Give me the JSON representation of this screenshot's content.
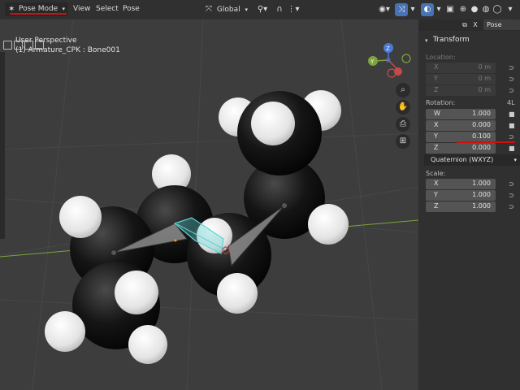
{
  "header": {
    "mode_label": "Pose Mode",
    "menu": [
      "View",
      "Select",
      "Pose"
    ],
    "transform_orientation": "Global"
  },
  "viewport": {
    "perspective_label": "User Perspective",
    "object_label": "(1) Armature_CPK : Bone001",
    "gizmo_axes": [
      "Z",
      "Y"
    ]
  },
  "panel": {
    "tab_label": "Pose Optio",
    "title": "Transform",
    "location_label": "Location:",
    "location": [
      {
        "axis": "X",
        "value": "0 m"
      },
      {
        "axis": "Y",
        "value": "0 m"
      },
      {
        "axis": "Z",
        "value": "0 m"
      }
    ],
    "rotation_label": "Rotation:",
    "rotation_badge": "4L",
    "rotation": [
      {
        "axis": "W",
        "value": "1.000"
      },
      {
        "axis": "X",
        "value": "0.000"
      },
      {
        "axis": "Y",
        "value": "0.100"
      },
      {
        "axis": "Z",
        "value": "0.000"
      }
    ],
    "rotation_mode": "Quaternion (WXYZ)",
    "scale_label": "Scale:",
    "scale": [
      {
        "axis": "X",
        "value": "1.000"
      },
      {
        "axis": "Y",
        "value": "1.000"
      },
      {
        "axis": "Z",
        "value": "1.000"
      }
    ]
  },
  "colors": {
    "carbon": "#1a1a1a",
    "hydrogen": "#e8e8e8",
    "bone_selected": "#5fd3d3",
    "annotation_red": "#d10f0f",
    "accent": "#4772b3"
  }
}
